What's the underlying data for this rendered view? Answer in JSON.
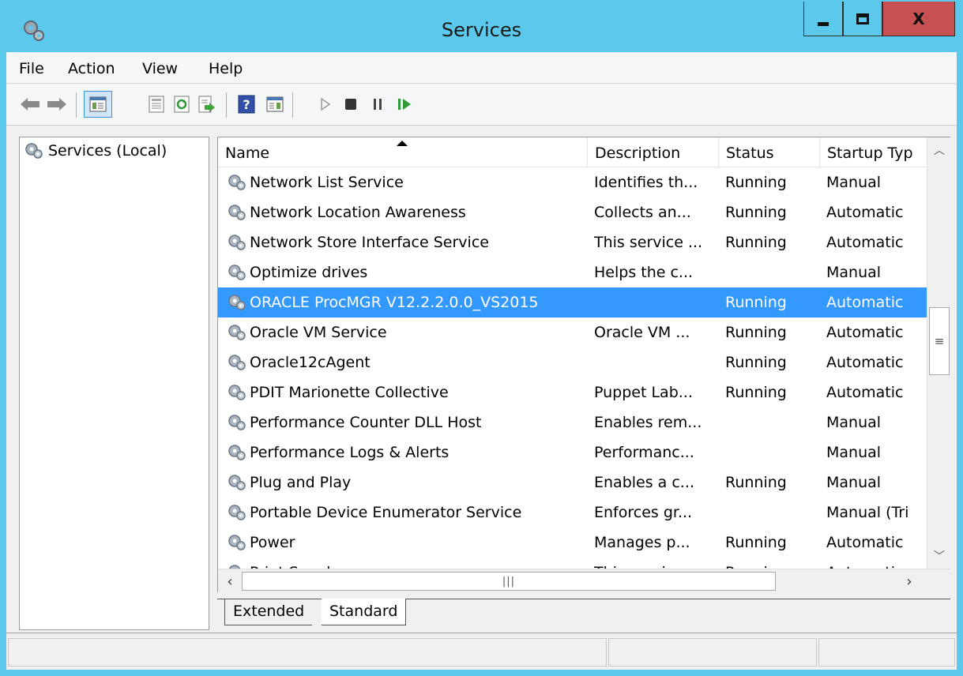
{
  "window": {
    "title": "Services",
    "controls": {
      "minimize": "minimize",
      "maximize": "maximize",
      "close": "X"
    }
  },
  "menu": [
    "File",
    "Action",
    "View",
    "Help"
  ],
  "toolbar": {
    "buttons": [
      "back-icon",
      "forward-icon",
      "show-hide-console-tree-icon",
      "properties-icon",
      "refresh-icon",
      "export-list-icon",
      "help-icon",
      "show-action-pane-icon",
      "start-service-icon",
      "stop-service-icon",
      "pause-service-icon",
      "resume-service-icon"
    ]
  },
  "tree": {
    "root_label": "Services (Local)"
  },
  "list": {
    "columns": [
      "Name",
      "Description",
      "Status",
      "Startup Typ"
    ],
    "sort_column": "Name",
    "rows": [
      {
        "name": "Network List Service",
        "description": "Identifies th...",
        "status": "Running",
        "startup": "Manual"
      },
      {
        "name": "Network Location Awareness",
        "description": "Collects an...",
        "status": "Running",
        "startup": "Automatic"
      },
      {
        "name": "Network Store Interface Service",
        "description": "This service ...",
        "status": "Running",
        "startup": "Automatic"
      },
      {
        "name": "Optimize drives",
        "description": "Helps the c...",
        "status": "",
        "startup": "Manual"
      },
      {
        "name": "ORACLE ProcMGR V12.2.2.0.0_VS2015",
        "description": "",
        "status": "Running",
        "startup": "Automatic",
        "selected": true
      },
      {
        "name": "Oracle VM Service",
        "description": "Oracle VM ...",
        "status": "Running",
        "startup": "Automatic"
      },
      {
        "name": "Oracle12cAgent",
        "description": "",
        "status": "Running",
        "startup": "Automatic"
      },
      {
        "name": "PDIT Marionette Collective",
        "description": "Puppet Lab...",
        "status": "Running",
        "startup": "Automatic"
      },
      {
        "name": "Performance Counter DLL Host",
        "description": "Enables rem...",
        "status": "",
        "startup": "Manual"
      },
      {
        "name": "Performance Logs & Alerts",
        "description": "Performanc...",
        "status": "",
        "startup": "Manual"
      },
      {
        "name": "Plug and Play",
        "description": "Enables a c...",
        "status": "Running",
        "startup": "Manual"
      },
      {
        "name": "Portable Device Enumerator Service",
        "description": "Enforces gr...",
        "status": "",
        "startup": "Manual (Tri"
      },
      {
        "name": "Power",
        "description": "Manages p...",
        "status": "Running",
        "startup": "Automatic"
      },
      {
        "name": "Print Spooler",
        "description": "This service ...",
        "status": "Running",
        "startup": "Automatic"
      }
    ]
  },
  "tabs": [
    "Extended",
    "Standard"
  ],
  "active_tab": "Standard",
  "colors": {
    "titlebar": "#5bc8ec",
    "selection": "#3399ff",
    "close_button": "#c75050"
  }
}
